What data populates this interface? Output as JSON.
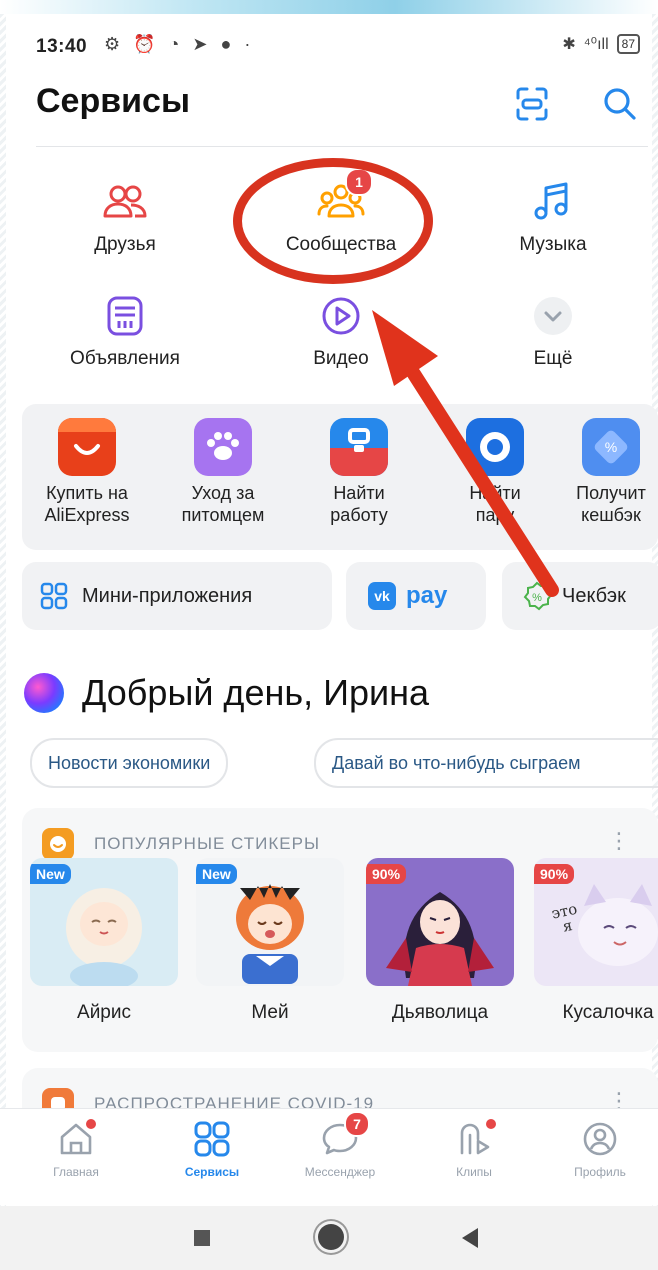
{
  "status_bar": {
    "time": "13:40",
    "left_icons": "⚙ ⏰ ◔ ➤ ● ·",
    "bt": "✱",
    "signal": "⁴⁰ıll",
    "battery": "87"
  },
  "header": {
    "title": "Сервисы"
  },
  "services": [
    {
      "label": "Друзья",
      "icon": "users-icon",
      "color": "#e64646"
    },
    {
      "label": "Сообщества",
      "icon": "community-icon",
      "color": "#ffa000",
      "badge": "1"
    },
    {
      "label": "Музыка",
      "icon": "music-icon",
      "color": "#2688eb"
    },
    {
      "label": "Объявления",
      "icon": "classifieds-icon",
      "color": "#7a4fe0"
    },
    {
      "label": "Видео",
      "icon": "play-icon",
      "color": "#7a4fe0"
    },
    {
      "label": "Ещё",
      "icon": "chevron-down-icon",
      "color": "#99a2ad"
    }
  ],
  "mini_apps": [
    {
      "line1": "Купить на",
      "line2": "AliExpress",
      "color": "#e8401a"
    },
    {
      "line1": "Уход за",
      "line2": "питомцем",
      "color": "#a674f0"
    },
    {
      "line1": "Найти",
      "line2": "работу",
      "color": "#2688eb"
    },
    {
      "line1": "Найти",
      "line2": "пару",
      "color": "#1d6fe0"
    },
    {
      "line1": "Получит",
      "line2": "кешбэк",
      "color": "#4f8ef0"
    }
  ],
  "chips": {
    "mini_apps": "Мини-приложения",
    "pay": "pay",
    "cashback": "Чекбэк"
  },
  "greeting": "Добрый день, Ирина",
  "suggestions": [
    "Новости экономики",
    "Давай во что-нибудь сыграем"
  ],
  "stickers_card": {
    "title": "ПОПУЛЯРНЫЕ СТИКЕРЫ",
    "items": [
      {
        "name": "Айрис",
        "badge": "New",
        "badge_color": "#2688eb",
        "bg": "#d9ecf4"
      },
      {
        "name": "Мей",
        "badge": "New",
        "badge_color": "#2688eb",
        "bg": "#f2f4f6"
      },
      {
        "name": "Дьяволица",
        "badge": "90%",
        "badge_color": "#e64646",
        "bg": "#8a6fc9"
      },
      {
        "name": "Кусалочка",
        "badge": "90%",
        "badge_color": "#e64646",
        "bg": "#ece6f6",
        "caption": "это я"
      }
    ]
  },
  "covid_card": {
    "title": "РАСПРОСТРАНЕНИЕ COVID-19"
  },
  "tabbar": [
    {
      "label": "Главная",
      "icon": "home-icon",
      "dot": true
    },
    {
      "label": "Сервисы",
      "icon": "services-icon",
      "active": true
    },
    {
      "label": "Мессенджер",
      "icon": "messenger-icon",
      "badge": "7"
    },
    {
      "label": "Клипы",
      "icon": "clips-icon",
      "dot": true
    },
    {
      "label": "Профиль",
      "icon": "profile-icon"
    }
  ],
  "annotation_colors": {
    "highlight": "#d8331f"
  }
}
